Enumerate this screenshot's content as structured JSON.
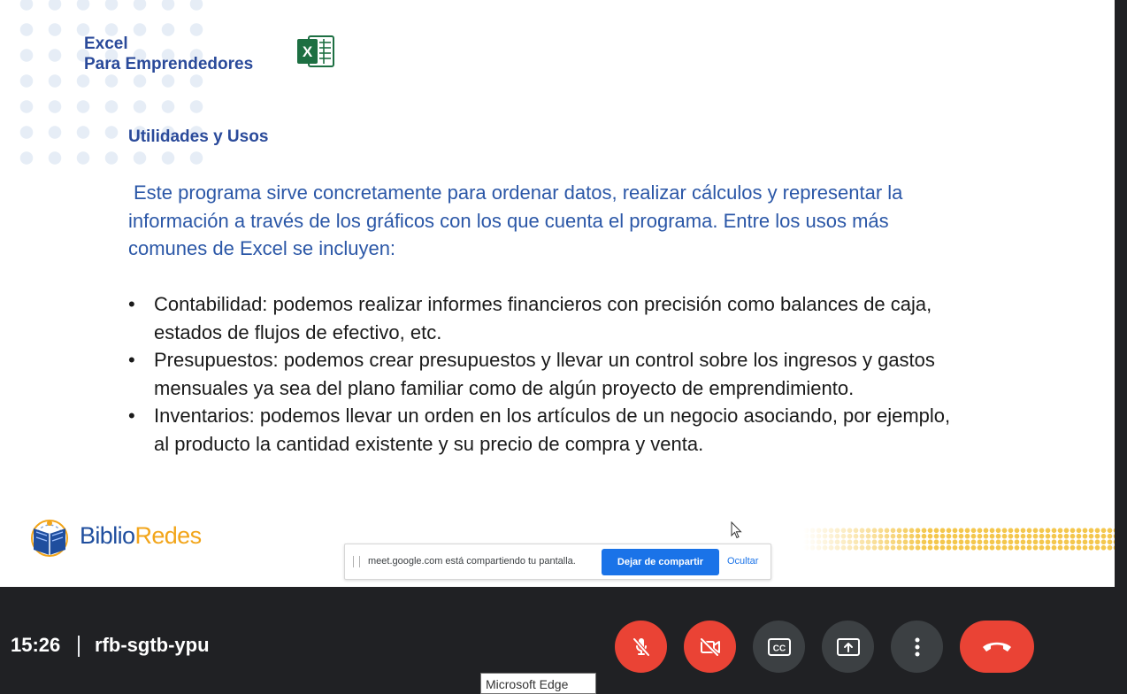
{
  "slide": {
    "brand_line1": "Excel",
    "brand_line2": "Para Emprendedores",
    "excel_logo_letter": "X",
    "section_title": "Utilidades y Usos",
    "intro": "Este programa sirve concretamente para ordenar datos, realizar cálculos y representar la información a través de los gráficos con los que cuenta el programa. Entre los usos más comunes de Excel se incluyen:",
    "items": [
      "Contabilidad: podemos realizar informes financieros con precisión como balances de caja, estados de flujos de efectivo, etc.",
      "Presupuestos: podemos crear presupuestos y llevar un control sobre los ingresos y gastos mensuales ya sea del plano familiar como de algún proyecto de emprendimiento.",
      "Inventarios: podemos llevar un orden en los artículos de un negocio asociando, por ejemplo, al producto la cantidad existente y su precio de compra y venta."
    ],
    "footer_logo_part1": "Biblio",
    "footer_logo_part2": "Redes"
  },
  "share_bar": {
    "message": "meet.google.com está compartiendo tu pantalla.",
    "stop_label": "Dejar de compartir",
    "hide_label": "Ocultar"
  },
  "meeting": {
    "time": "15:26",
    "code": "rfb-sgtb-ypu"
  },
  "controls": {
    "mic_icon": "mic-off-icon",
    "camera_icon": "videocam-off-icon",
    "captions_label": "CC",
    "present_icon": "present-screen-icon",
    "more_icon": "more-vertical-icon",
    "leave_icon": "call-end-icon"
  },
  "tooltip": {
    "text": "Microsoft Edge"
  },
  "colors": {
    "brand_blue": "#2a4a9a",
    "excel_green": "#1d6f42",
    "meet_red": "#ea4335",
    "meet_gray": "#3c4043",
    "meet_bg": "#202124",
    "share_blue": "#1a73e8",
    "biblio_orange": "#f2a51a"
  }
}
